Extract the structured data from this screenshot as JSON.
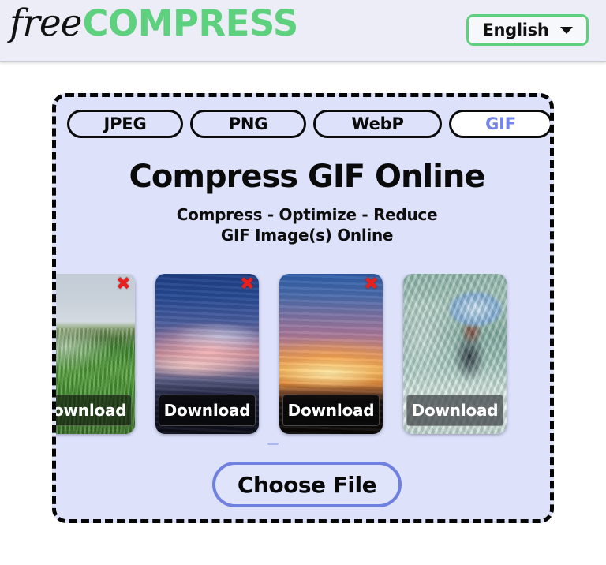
{
  "header": {
    "logo": {
      "part1": "free",
      "part2": "COMPRESS",
      "accent_color": "#5ed17f"
    },
    "language": {
      "label": "English",
      "caret_icon": "chevron-down-icon",
      "border_color": "#5ed17f"
    }
  },
  "panel": {
    "title": "Compress GIF Online",
    "subtitle": "Compress - Optimize - Reduce\nGIF Image(s) Online",
    "background_color": "#dde2fa",
    "border_style": "dashed",
    "border_color": "#050505",
    "tabs": [
      {
        "label": "JPEG",
        "active": false
      },
      {
        "label": "PNG",
        "active": false
      },
      {
        "label": "WebP",
        "active": false
      },
      {
        "label": "GIF",
        "active": true
      }
    ],
    "active_tab_text_color": "#7584e8",
    "thumbnails": [
      {
        "download_label": "Download",
        "remove_icon": "close-icon",
        "art": "art-field",
        "bar_style": "semi",
        "alt": "green rice field under overcast sky"
      },
      {
        "download_label": "Download",
        "remove_icon": "close-icon",
        "art": "art-dusk",
        "bar_style": "",
        "alt": "pink and blue dusk clouds over dark treeline"
      },
      {
        "download_label": "Download",
        "remove_icon": "close-icon",
        "art": "art-sunset",
        "bar_style": "",
        "alt": "orange sunset with silhouetted trees"
      },
      {
        "download_label": "Download",
        "remove_icon": "close-icon",
        "art": "art-rapids",
        "bar_style": "translucent",
        "alt": "kayaker in white water rapids"
      }
    ],
    "choose_file": {
      "label": "Choose File",
      "border_color": "#6f80df"
    }
  }
}
